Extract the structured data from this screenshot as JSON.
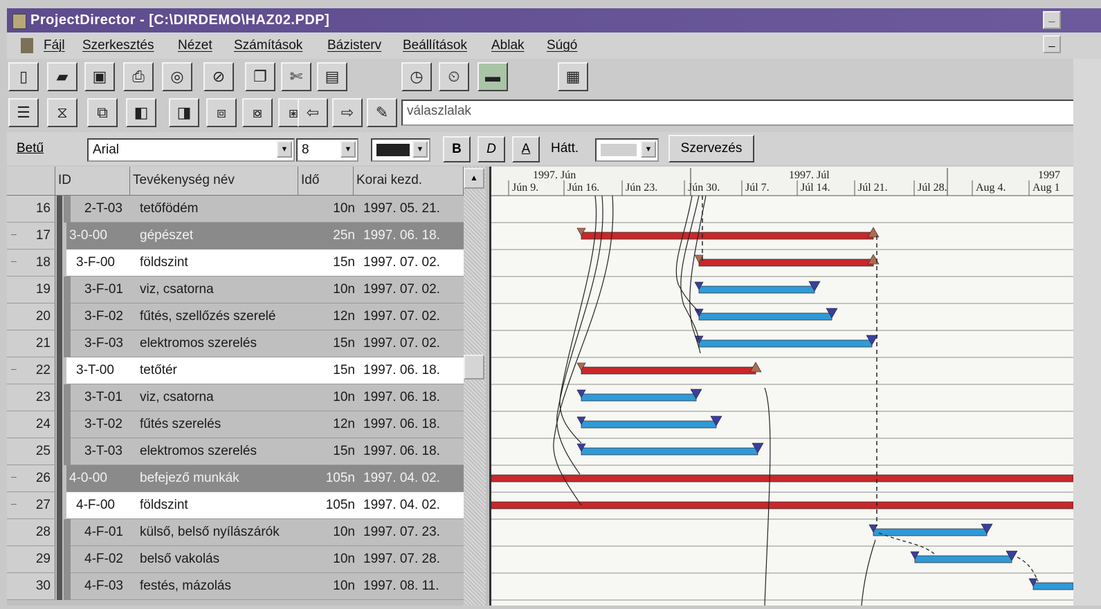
{
  "window": {
    "title": "ProjectDirector - [C:\\DIRDEMO\\HAZ02.PDP]",
    "minimize_label": "_"
  },
  "menu": [
    "Fájl",
    "Szerkesztés",
    "Nézet",
    "Számítások",
    "Bázisterv",
    "Beállítások",
    "Ablak",
    "Súgó"
  ],
  "toolbar1_icons": [
    "new-file-icon",
    "open-folder-icon",
    "save-icon",
    "print-icon",
    "print-preview-icon",
    "cancel-icon",
    "copy-icon",
    "cut-icon",
    "paste-icon",
    "clock-icon",
    "timer-icon",
    "toolbox-icon",
    "calculator-icon"
  ],
  "toolbar2_icons": [
    "indent-icon",
    "outdent-icon",
    "link-icon",
    "unlink-icon",
    "layer-icon",
    "layer-multi-icon",
    "layer-split-icon",
    "layer-move-icon",
    "arrow-left-icon",
    "arrow-right-icon",
    "edit-icon"
  ],
  "toolbar2": {
    "field_value": "válaszlalak"
  },
  "format": {
    "font_label": "Betű",
    "font_value": "Arial",
    "size_value": "8",
    "bold": "B",
    "italic": "D",
    "underline": "A",
    "background_label": "Hátt.",
    "organize_button": "Szervezés"
  },
  "columns": {
    "id": "ID",
    "name": "Tevékenység név",
    "duration": "Idő",
    "early_start": "Korai kezd."
  },
  "rows": [
    {
      "num": "16",
      "id": "2-T-03",
      "name": "tetőfödém",
      "dur": "10n",
      "start": "1997. 05. 21.",
      "type": "task",
      "indent": 1
    },
    {
      "num": "17",
      "id": "3-0-00",
      "name": "gépészet",
      "dur": "25n",
      "start": "1997. 06. 18.",
      "type": "group",
      "indent": 0
    },
    {
      "num": "18",
      "id": "3-F-00",
      "name": "földszint",
      "dur": "15n",
      "start": "1997. 07. 02.",
      "type": "summary",
      "indent": 0
    },
    {
      "num": "19",
      "id": "3-F-01",
      "name": "viz, csatorna",
      "dur": "10n",
      "start": "1997. 07. 02.",
      "type": "task",
      "indent": 1
    },
    {
      "num": "20",
      "id": "3-F-02",
      "name": "fűtés, szellőzés szerelé",
      "dur": "12n",
      "start": "1997. 07. 02.",
      "type": "task",
      "indent": 1
    },
    {
      "num": "21",
      "id": "3-F-03",
      "name": "elektromos szerelés",
      "dur": "15n",
      "start": "1997. 07. 02.",
      "type": "task",
      "indent": 1
    },
    {
      "num": "22",
      "id": "3-T-00",
      "name": "tetőtér",
      "dur": "15n",
      "start": "1997. 06. 18.",
      "type": "summary",
      "indent": 0
    },
    {
      "num": "23",
      "id": "3-T-01",
      "name": "viz, csatorna",
      "dur": "10n",
      "start": "1997. 06. 18.",
      "type": "task",
      "indent": 1
    },
    {
      "num": "24",
      "id": "3-T-02",
      "name": "fűtés szerelés",
      "dur": "12n",
      "start": "1997. 06. 18.",
      "type": "task",
      "indent": 1
    },
    {
      "num": "25",
      "id": "3-T-03",
      "name": "elektromos szerelés",
      "dur": "15n",
      "start": "1997. 06. 18.",
      "type": "task",
      "indent": 1
    },
    {
      "num": "26",
      "id": "4-0-00",
      "name": "befejező munkák",
      "dur": "105n",
      "start": "1997. 04. 02.",
      "type": "group",
      "indent": 0
    },
    {
      "num": "27",
      "id": "4-F-00",
      "name": "földszint",
      "dur": "105n",
      "start": "1997. 04. 02.",
      "type": "summary",
      "indent": 0
    },
    {
      "num": "28",
      "id": "4-F-01",
      "name": "külső, belső nyílászárók",
      "dur": "10n",
      "start": "1997. 07. 23.",
      "type": "task",
      "indent": 1
    },
    {
      "num": "29",
      "id": "4-F-02",
      "name": "belső vakolás",
      "dur": "10n",
      "start": "1997. 07. 28.",
      "type": "task",
      "indent": 1
    },
    {
      "num": "30",
      "id": "4-F-03",
      "name": "festés, mázolás",
      "dur": "10n",
      "start": "1997. 08. 11.",
      "type": "task",
      "indent": 1
    }
  ],
  "timeline": {
    "months": [
      {
        "label": "1997. Jún"
      },
      {
        "label": "1997. Júl"
      },
      {
        "label": "1997"
      }
    ],
    "weeks": [
      "Jún 9.",
      "Jún 16.",
      "Jún 23.",
      "Jún 30.",
      "Júl 7.",
      "Júl 14.",
      "Júl 21.",
      "Júl 28.",
      "Aug 4.",
      "Aug 1"
    ]
  },
  "colors": {
    "summary_bar": "#c8282a",
    "task_bar": "#2f9ad8",
    "group_row": "#8a8a8a",
    "titlebar": "#5d4c8e"
  }
}
